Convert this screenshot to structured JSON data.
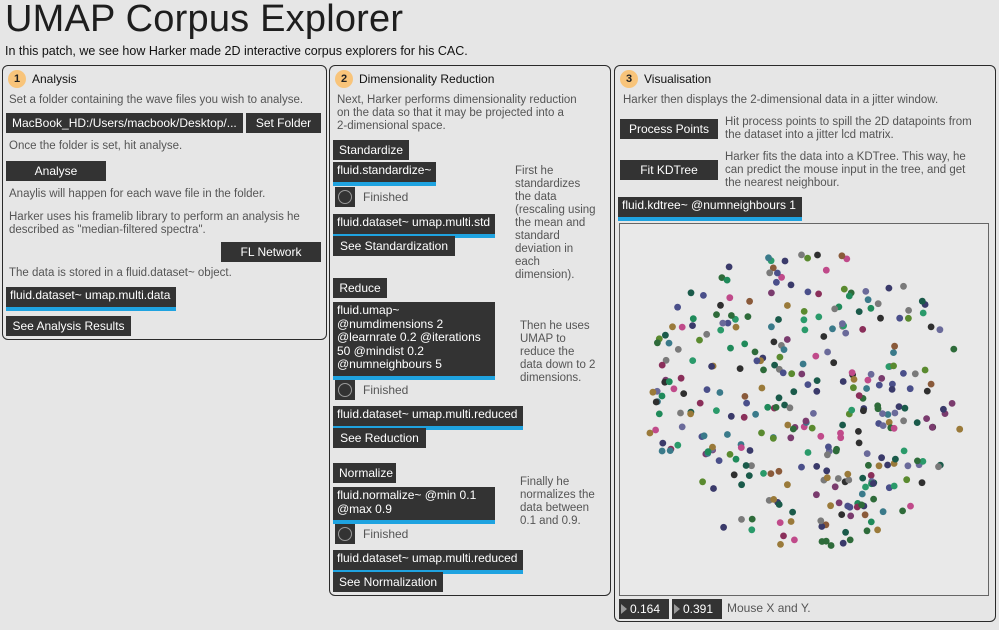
{
  "header": {
    "title": "UMAP Corpus Explorer",
    "subtitle": "In this patch, we see how Harker made 2D interactive corpus explorers for his CAC."
  },
  "analysis": {
    "number": "1",
    "title": "Analysis",
    "note_folder": "Set a folder containing the wave files you wish to analyse.",
    "folder_path": "MacBook_HD:/Users/macbook/Desktop/...",
    "set_folder_label": "Set Folder",
    "note_once": "Once the folder is set, hit analyse.",
    "analyse_label": "Analyse",
    "note_each": "Anaylis will happen for each wave file in the folder.",
    "note_framelib_1": "Harker uses his framelib library to perform an analysis he",
    "note_framelib_2": "described as \"median-filtered spectra\".",
    "fl_network_label": "FL Network",
    "note_stored": "The data is stored in a fluid.dataset~ object.",
    "dataset_object": "fluid.dataset~ umap.multi.data",
    "see_results_label": "See Analysis Results"
  },
  "reduction": {
    "number": "2",
    "title": "Dimensionality Reduction",
    "note_intro_1": "Next, Harker performs dimensionality reduction",
    "note_intro_2": "on the data so that it may be projected into a",
    "note_intro_3": "2-dimensional space.",
    "standardize_label": "Standardize",
    "standardize_object": "fluid.standardize~",
    "finished_label": "Finished",
    "std_dataset_object": "fluid.dataset~ umap.multi.std",
    "see_std_label": "See Standardization",
    "std_note": [
      "First he",
      "standardizes",
      "the data",
      "(rescaling using",
      "the mean and",
      "standard",
      "deviation in",
      "each",
      "dimension)."
    ],
    "reduce_label": "Reduce",
    "umap_object": [
      "fluid.umap~",
      "@numdimensions 2",
      "@learnrate 0.2 @iterations",
      "50 @mindist 0.2",
      "@numneighbours 5"
    ],
    "reduced_dataset_object": "fluid.dataset~ umap.multi.reduced",
    "see_reduction_label": "See Reduction",
    "umap_note": [
      "Then he uses",
      "UMAP to",
      "reduce the",
      "data down to 2",
      "dimensions."
    ],
    "normalize_label": "Normalize",
    "normalize_object": [
      "fluid.normalize~ @min 0.1",
      "@max 0.9"
    ],
    "norm_dataset_object": "fluid.dataset~ umap.multi.reduced",
    "see_norm_label": "See Normalization",
    "norm_note": [
      "Finally he",
      "normalizes the",
      "data between",
      "0.1 and 0.9."
    ]
  },
  "visualisation": {
    "number": "3",
    "title": "Visualisation",
    "note_displays": "Harker then displays the 2-dimensional data in a jitter window.",
    "process_points_label": "Process Points",
    "process_note_1": "Hit process points to spill the 2D datapoints from",
    "process_note_2": "the dataset into a jitter lcd matrix.",
    "fit_kdtree_label": "Fit KDTree",
    "kdtree_note_1": "Harker fits the data into a KDTree. This way, he",
    "kdtree_note_2": "can predict the mouse input in the tree, and get",
    "kdtree_note_3": "the nearest neighbour.",
    "kdtree_object": "fluid.kdtree~ @numneighbours 1",
    "mouse_x": "0.164",
    "mouse_y": "0.391",
    "mouse_label": "Mouse X and Y."
  },
  "colors": {
    "background": "#e6e6e6",
    "object_fill": "#333333",
    "outlet_bar": "#1fa3e0",
    "badge": "#f8c47a"
  },
  "icons": {
    "toggle": "toggle-circle-icon",
    "numbox_arrow": "triangle-right-icon"
  }
}
